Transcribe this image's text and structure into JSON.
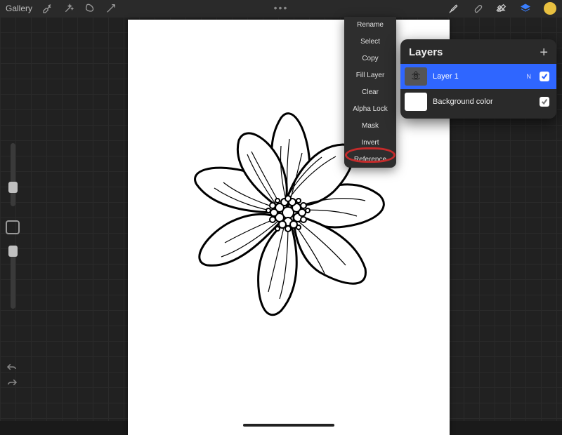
{
  "toolbar": {
    "gallery_label": "Gallery"
  },
  "dropdown": {
    "items": [
      "Rename",
      "Select",
      "Copy",
      "Fill Layer",
      "Clear",
      "Alpha Lock",
      "Mask",
      "Invert",
      "Reference"
    ],
    "highlighted_index": 8
  },
  "layers_panel": {
    "title": "Layers",
    "layers": [
      {
        "name": "Layer 1",
        "badge": "N",
        "selected": true,
        "visible": true
      },
      {
        "name": "Background color",
        "selected": false,
        "visible": true
      }
    ]
  },
  "colors": {
    "accent": "#2f66ff",
    "swatch": "#e8c040",
    "highlight_ring": "#c42b2b"
  }
}
